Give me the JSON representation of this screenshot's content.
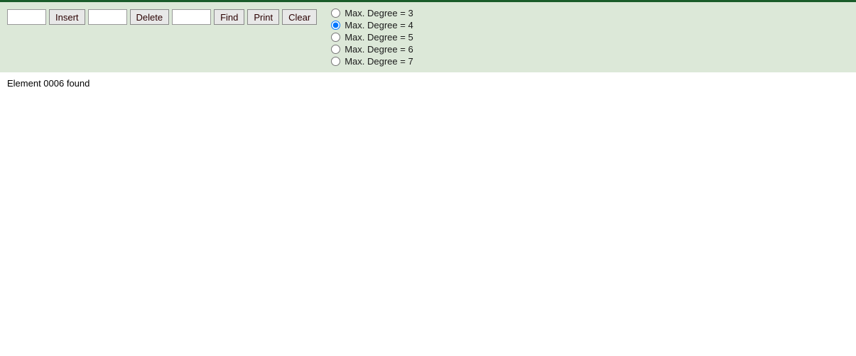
{
  "toolbar": {
    "insert_button_label": "Insert",
    "delete_button_label": "Delete",
    "find_button_label": "Find",
    "print_button_label": "Print",
    "clear_button_label": "Clear",
    "insert_input_value": "",
    "delete_input_value": "",
    "find_input_value": ""
  },
  "radio_options": [
    {
      "label": "Max. Degree = 3",
      "value": "3",
      "checked": false
    },
    {
      "label": "Max. Degree = 4",
      "value": "4",
      "checked": true
    },
    {
      "label": "Max. Degree = 5",
      "value": "5",
      "checked": false
    },
    {
      "label": "Max. Degree = 6",
      "value": "6",
      "checked": false
    },
    {
      "label": "Max. Degree = 7",
      "value": "7",
      "checked": false
    }
  ],
  "status": {
    "message": "Element 0006 found"
  }
}
